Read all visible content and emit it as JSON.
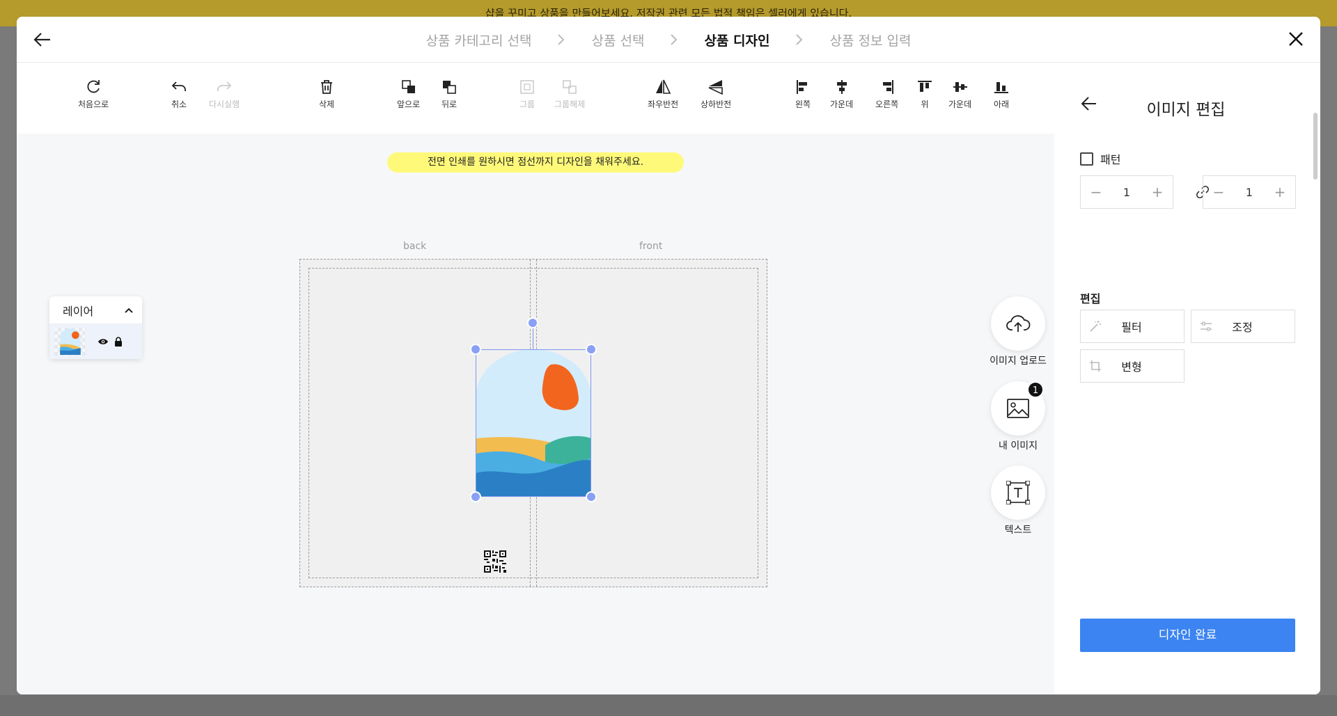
{
  "banner": {
    "text": "샵을 꾸미고 상품을 만들어보세요. 저작권 관련 모든 법적 책임은 셀러에게 있습니다."
  },
  "steps": [
    {
      "label": "상품 카테고리 선택",
      "active": false
    },
    {
      "label": "상품 선택",
      "active": false
    },
    {
      "label": "상품 디자인",
      "active": true
    },
    {
      "label": "상품 정보 입력",
      "active": false
    }
  ],
  "toolbar": {
    "reset": "처음으로",
    "undo": "취소",
    "redo": "다시실행",
    "delete": "삭제",
    "front": "앞으로",
    "back": "뒤로",
    "group": "그룹",
    "ungroup": "그룹해제",
    "flip_h": "좌우반전",
    "flip_v": "상하반전",
    "align_left": "왼쪽",
    "align_center": "가운데",
    "align_right": "오른쪽",
    "align_top": "위",
    "align_middle": "가운데",
    "align_bottom": "아래"
  },
  "canvas": {
    "hint": "전면 인쇄를 원하시면 점선까지 디자인을 채워주세요.",
    "back_label": "back",
    "front_label": "front"
  },
  "layers": {
    "title": "레이어"
  },
  "fabs": {
    "upload": "이미지 업로드",
    "my_images": "내 이미지",
    "my_images_count": "1",
    "text": "텍스트"
  },
  "right_panel": {
    "title": "이미지 편집",
    "pattern_label": "패턴",
    "stepper_1_value": "1",
    "stepper_2_value": "1",
    "edit_section": "편집",
    "filter": "필터",
    "adjust": "조정",
    "transform": "변형",
    "done": "디자인 완료"
  },
  "colors": {
    "accent": "#3b84f1",
    "highlight": "#fff200",
    "hint_bg": "#fff97a",
    "selection": "#7d95f3"
  }
}
